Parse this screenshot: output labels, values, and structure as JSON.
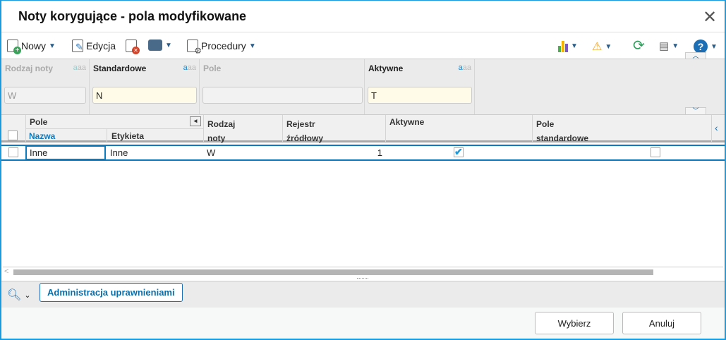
{
  "window": {
    "title": "Noty korygujące - pola modyfikowane"
  },
  "toolbar": {
    "new": "Nowy",
    "edit": "Edycja",
    "procedures": "Procedury"
  },
  "filters": [
    {
      "label": "Rodzaj noty",
      "value": "W"
    },
    {
      "label": "Standardowe",
      "value": "N"
    },
    {
      "label": "Pole",
      "value": ""
    },
    {
      "label": "Aktywne",
      "value": "T"
    }
  ],
  "filter_case_icon": "aa",
  "grid": {
    "group": "Pole",
    "headers": {
      "nazwa": "Nazwa",
      "etykieta": "Etykieta",
      "rodzaj1": "Rodzaj",
      "rodzaj2": "noty",
      "rejestr1": "Rejestr",
      "rejestr2": "źródłowy",
      "aktywne": "Aktywne",
      "pole1": "Pole",
      "pole2": "standardowe"
    },
    "rows": [
      {
        "nazwa": "Inne",
        "etykieta": "Inne",
        "rodzaj": "W",
        "rejestr": "1",
        "aktywne": true,
        "standardowe": false
      }
    ]
  },
  "bottom": {
    "admin": "Administracja uprawnieniami"
  },
  "footer": {
    "select": "Wybierz",
    "cancel": "Anuluj"
  },
  "colors": {
    "accent": "#0b7bc0",
    "border": "#1a9be0"
  }
}
